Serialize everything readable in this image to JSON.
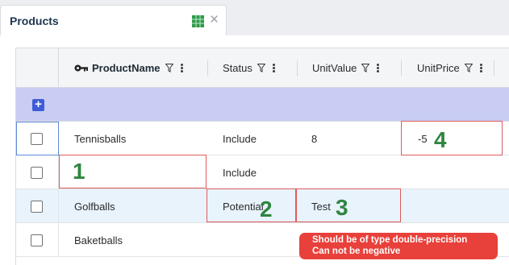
{
  "tab": {
    "title": "Products",
    "sheet_icon": "spreadsheet-icon",
    "close_icon": "close-icon"
  },
  "grid": {
    "columns": [
      {
        "key": "ProductName",
        "label": "ProductName",
        "primary_key": true
      },
      {
        "key": "Status",
        "label": "Status"
      },
      {
        "key": "UnitValue",
        "label": "UnitValue"
      },
      {
        "key": "UnitPrice",
        "label": "UnitPrice"
      }
    ],
    "add_row_label": "+",
    "rows": [
      {
        "ProductName": "Tennisballs",
        "Status": "Include",
        "UnitValue": "8",
        "UnitPrice": "-5"
      },
      {
        "ProductName": "",
        "Status": "Include",
        "UnitValue": "",
        "UnitPrice": ""
      },
      {
        "ProductName": "Golfballs",
        "Status": "Potential",
        "UnitValue": "Test",
        "UnitPrice": ""
      },
      {
        "ProductName": "Baketballs",
        "Status": "",
        "UnitValue": "",
        "UnitPrice": ""
      }
    ]
  },
  "annotations": {
    "n1": "1",
    "n2": "2",
    "n3": "3",
    "n4": "4"
  },
  "tooltip": {
    "line1": "Should be of type double-precision",
    "line2": "Can not be negative"
  },
  "colors": {
    "accent": "#3f5bd6",
    "add_row_bg": "#c9cdf3",
    "error": "#e05b5b",
    "tooltip_bg": "#e8403a",
    "annotation_number": "#2e8540",
    "highlight_row": "#e8f3fc"
  }
}
